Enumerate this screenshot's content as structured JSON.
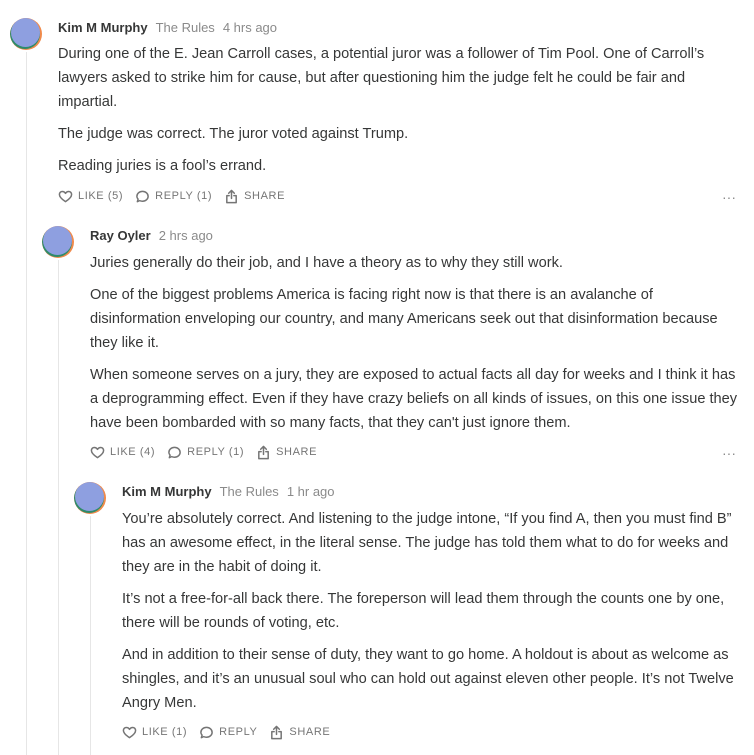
{
  "comments": [
    {
      "author": "Kim M Murphy",
      "badge": "The Rules",
      "time": "4 hrs ago",
      "paragraphs": [
        "During one of the E. Jean Carroll cases, a potential juror was a follower of Tim Pool. One of Carroll’s lawyers asked to strike him for cause, but after questioning him the judge felt he could be fair and impartial.",
        "The judge was correct. The juror voted against Trump.",
        "Reading juries is a fool’s errand."
      ],
      "like": "LIKE (5)",
      "reply": "REPLY (1)",
      "share": "SHARE",
      "more": "···"
    },
    {
      "author": "Ray Oyler",
      "badge": "",
      "time": "2 hrs ago",
      "paragraphs": [
        "Juries generally do their job, and I have a theory as to why they still work.",
        "One of the biggest problems America is facing right now is that there is an avalanche of disinformation enveloping our country, and many Americans seek out that disinformation because they like it.",
        "When someone serves on a jury, they are exposed to actual facts all day for weeks and I think it has a deprogramming effect. Even if they have crazy beliefs on all kinds of issues, on this one issue they have been bombarded with so many facts, that they can't just ignore them."
      ],
      "like": "LIKE (4)",
      "reply": "REPLY (1)",
      "share": "SHARE",
      "more": "···"
    },
    {
      "author": "Kim M Murphy",
      "badge": "The Rules",
      "time": "1 hr ago",
      "paragraphs": [
        "You’re absolutely correct. And listening to the judge intone, “If you find A, then you must find B” has an awesome effect, in the literal sense. The judge has told them what to do for weeks and they are in the habit of doing it.",
        "It’s not a free-for-all back there. The foreperson will lead them through the counts one by one, there will be rounds of voting, etc.",
        "And in addition to their sense of duty, they want to go home. A holdout is about as welcome as shingles, and it’s an unusual soul who can hold out against eleven other people. It’s not Twelve Angry Men."
      ],
      "like": "LIKE (1)",
      "reply": "REPLY",
      "share": "SHARE",
      "more": ""
    }
  ],
  "icons": {
    "avatar": "user-avatar",
    "like": "heart-icon",
    "reply": "speech-bubble-icon",
    "share": "share-icon",
    "more": "more-options-icon"
  },
  "colors": {
    "text": "#363737",
    "muted": "#8a8a8a",
    "thread": "#e6e6e6",
    "avatar_purple": "#8e9fe0",
    "avatar_orange": "#f08a4b",
    "avatar_green": "#2e8b6a"
  }
}
